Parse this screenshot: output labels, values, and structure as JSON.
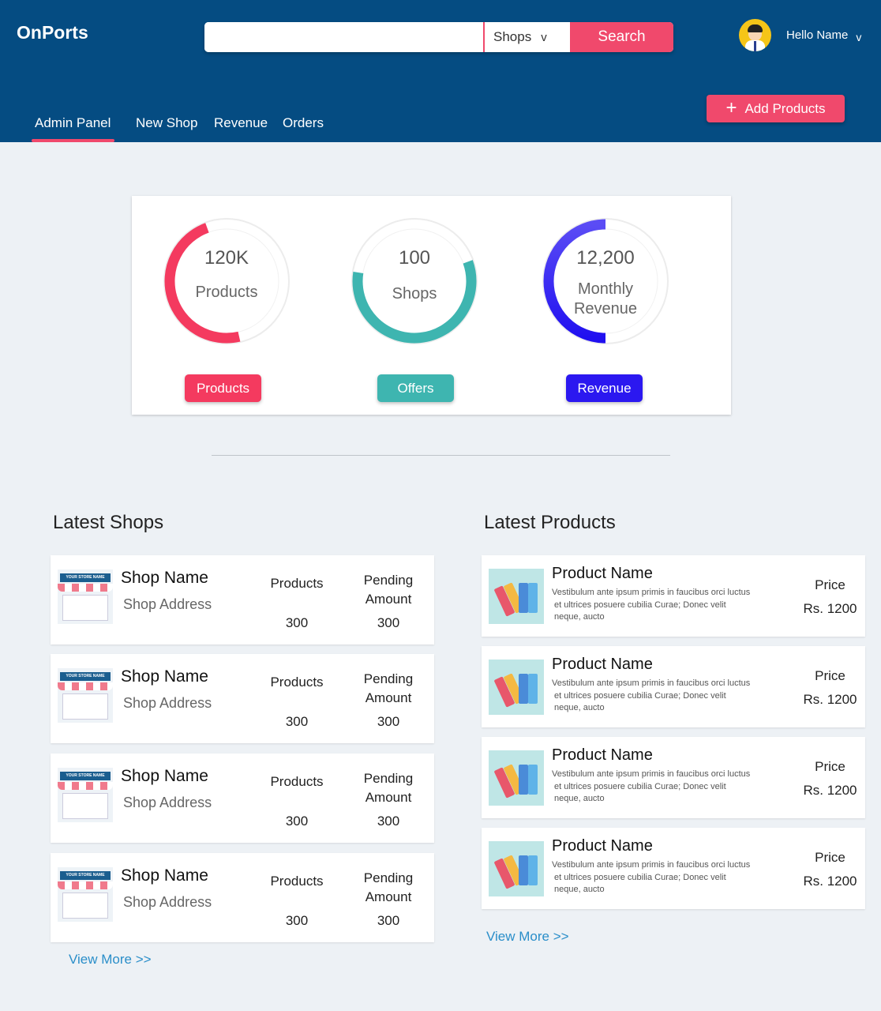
{
  "header": {
    "logo": "OnPorts",
    "search": {
      "placeholder": "",
      "category": "Shops",
      "button": "Search"
    },
    "user": {
      "greeting": "Hello Name"
    },
    "nav": [
      "Admin Panel",
      "New Shop",
      "Revenue",
      "Orders"
    ],
    "add_button": "Add Products"
  },
  "stats": [
    {
      "value": "120K",
      "label": "Products",
      "button": "Products",
      "color": "#f43a5f",
      "fill": 0.48
    },
    {
      "value": "100",
      "label": "Shops",
      "button": "Offers",
      "color": "#3eb5b0",
      "fill": 0.58
    },
    {
      "value": "12,200",
      "label": "Monthly Revenue",
      "label_line1": "Monthly",
      "label_line2": "Revenue",
      "button": "Revenue",
      "color": "#2b18f0",
      "fill": 0.5
    }
  ],
  "latest_shops": {
    "title": "Latest Shops",
    "store_sign": "YOUR STORE NAME",
    "col_products": "Products",
    "col_pending_1": "Pending",
    "col_pending_2": "Amount",
    "items": [
      {
        "name": "Shop Name",
        "address": "Shop Address",
        "products": "300",
        "pending": "300"
      },
      {
        "name": "Shop Name",
        "address": "Shop Address",
        "products": "300",
        "pending": "300"
      },
      {
        "name": "Shop Name",
        "address": "Shop Address",
        "products": "300",
        "pending": "300"
      },
      {
        "name": "Shop Name",
        "address": "Shop Address",
        "products": "300",
        "pending": "300"
      }
    ],
    "view_more": "View More >>"
  },
  "latest_products": {
    "title": "Latest Products",
    "items": [
      {
        "name": "Product Name",
        "desc_1": "Vestibulum ante ipsum primis in faucibus orci luctus",
        "desc_2": "et ultrices posuere cubilia Curae; Donec velit",
        "desc_3": "neque, aucto",
        "price_label": "Price",
        "price": "Rs. 1200"
      },
      {
        "name": "Product Name",
        "desc_1": "Vestibulum ante ipsum primis in faucibus orci luctus",
        "desc_2": "et ultrices posuere cubilia Curae; Donec velit",
        "desc_3": "neque, aucto",
        "price_label": "Price",
        "price": "Rs. 1200"
      },
      {
        "name": "Product Name",
        "desc_1": "Vestibulum ante ipsum primis in faucibus orci luctus",
        "desc_2": "et ultrices posuere cubilia Curae; Donec velit",
        "desc_3": "neque, aucto",
        "price_label": "Price",
        "price": "Rs. 1200"
      },
      {
        "name": "Product Name",
        "desc_1": "Vestibulum ante ipsum primis in faucibus orci luctus",
        "desc_2": "et ultrices posuere cubilia Curae; Donec velit",
        "desc_3": "neque, aucto",
        "price_label": "Price",
        "price": "Rs. 1200"
      }
    ],
    "view_more": "View More >>"
  }
}
